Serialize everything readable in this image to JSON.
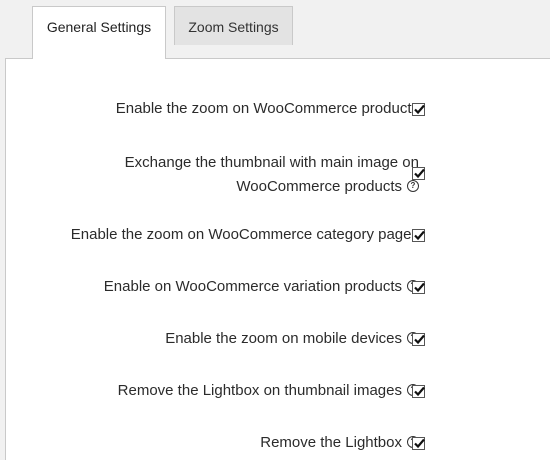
{
  "tabs": {
    "general": "General Settings",
    "zoom": "Zoom Settings"
  },
  "options": [
    {
      "label": "Enable the zoom on WooCommerce products",
      "checked": true,
      "help": false
    },
    {
      "label_line1": "Exchange the thumbnail with main image on",
      "label_line2": "WooCommerce products",
      "checked": true,
      "help": true
    },
    {
      "label": "Enable the zoom on WooCommerce category pages",
      "checked": true,
      "help": false
    },
    {
      "label": "Enable on WooCommerce variation products",
      "checked": true,
      "help": true
    },
    {
      "label": "Enable the zoom on mobile devices",
      "checked": true,
      "help": true
    },
    {
      "label": "Remove the Lightbox on thumbnail images",
      "checked": true,
      "help": true
    },
    {
      "label": "Remove the Lightbox",
      "checked": true,
      "help": true
    }
  ],
  "help_glyph": "?"
}
